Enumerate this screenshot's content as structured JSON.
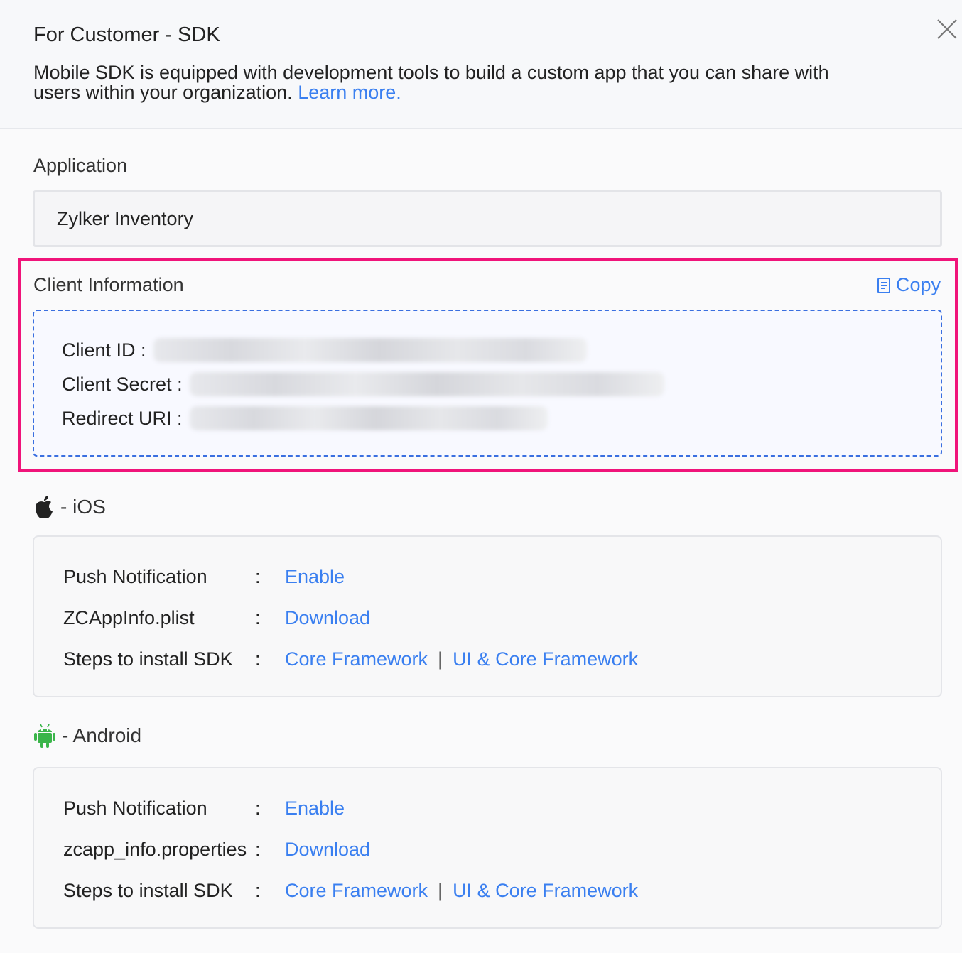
{
  "header": {
    "title": "For Customer - SDK",
    "description": "Mobile SDK is equipped with development tools to build a custom app that you can share with users within your organization.",
    "learn_more": "Learn more."
  },
  "application": {
    "label": "Application",
    "value": "Zylker Inventory"
  },
  "client_info": {
    "label": "Client Information",
    "copy_label": "Copy",
    "client_id_label": "Client ID :",
    "client_secret_label": "Client Secret :",
    "redirect_uri_label": "Redirect URI :"
  },
  "ios": {
    "label": "- iOS",
    "rows": [
      {
        "key": "Push Notification",
        "colon": ":",
        "value": "Enable"
      },
      {
        "key": "ZCAppInfo.plist",
        "colon": ":",
        "value": "Download"
      },
      {
        "key": "Steps to install SDK",
        "colon": ":",
        "value": "Core Framework",
        "separator": "|",
        "value2": "UI & Core Framework"
      }
    ]
  },
  "android": {
    "label": "- Android",
    "rows": [
      {
        "key": "Push Notification",
        "colon": ":",
        "value": "Enable"
      },
      {
        "key": "zcapp_info.properties",
        "colon": ":",
        "value": "Download"
      },
      {
        "key": "Steps to install SDK",
        "colon": ":",
        "value": "Core Framework",
        "separator": "|",
        "value2": "UI & Core Framework"
      }
    ]
  },
  "colors": {
    "link": "#3a7ff0",
    "highlight": "#f0147a",
    "android": "#3ab54a"
  }
}
